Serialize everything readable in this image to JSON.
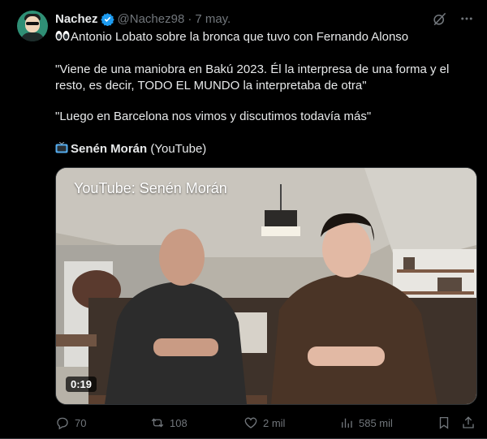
{
  "author": {
    "name": "Nachez",
    "handle": "@Nachez98",
    "separator": "·",
    "date": "7 may."
  },
  "tweet": {
    "line1": "Antonio Lobato sobre la bronca que tuvo con Fernando Alonso",
    "quote1": "\"Viene de una maniobra en Bakú 2023. Él la interpresa de una forma y el resto, es decir, TODO EL MUNDO la interpretaba de otra\"",
    "quote2": "\"Luego en Barcelona nos vimos y discutimos todavía más\"",
    "source_name": "Senén Morán",
    "source_suffix": " (YouTube)"
  },
  "media": {
    "watermark": "YouTube: Senén Morán",
    "duration": "0:19"
  },
  "actions": {
    "replies": "70",
    "reposts": "108",
    "likes": "2 mil",
    "views": "585 mil"
  },
  "colors": {
    "background": "#000000",
    "text": "#e7e9ea",
    "muted": "#71767b",
    "verified": "#1d9bf0"
  },
  "icons": [
    "verified-badge-icon",
    "grok-icon",
    "more-icon",
    "eyes-emoji-icon",
    "tv-emoji-icon",
    "reply-icon",
    "repost-icon",
    "like-icon",
    "views-icon",
    "bookmark-icon",
    "share-icon"
  ]
}
